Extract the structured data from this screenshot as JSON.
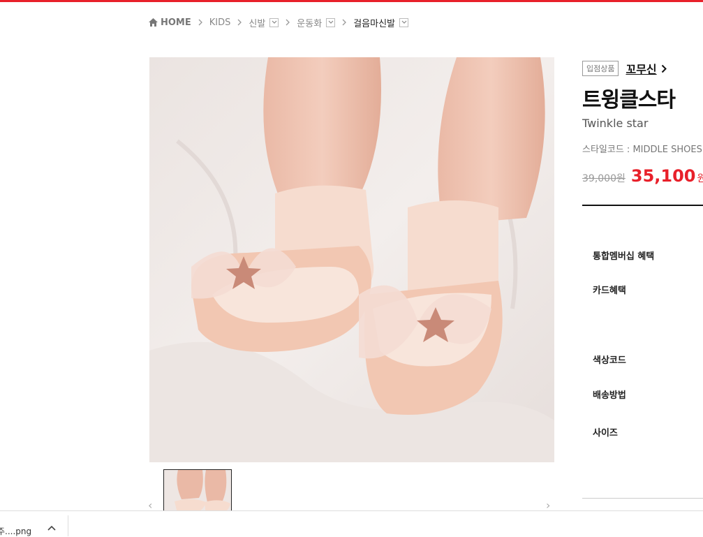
{
  "breadcrumb": {
    "home": "HOME",
    "items": [
      "KIDS",
      "신발",
      "운동화",
      "걸음마신발"
    ]
  },
  "product": {
    "badge": "입점상품",
    "brand": "꼬무신",
    "title": "트윙클스타",
    "name_en": "Twinkle star",
    "style_code": "스타일코드 : MIDDLE SHOES",
    "price_original": "39,000원",
    "price_sale": "35,100",
    "price_unit": "원",
    "price_extra": "["
  },
  "info_labels": [
    "통합멤버십 혜택",
    "카드혜택",
    "색상코드",
    "배송방법",
    "사이즈"
  ],
  "thumbnails": {
    "prev": "‹",
    "next": "›"
  },
  "download": {
    "filename": "주....png",
    "chevron": "^"
  },
  "colors": {
    "accent": "#e8202a"
  }
}
